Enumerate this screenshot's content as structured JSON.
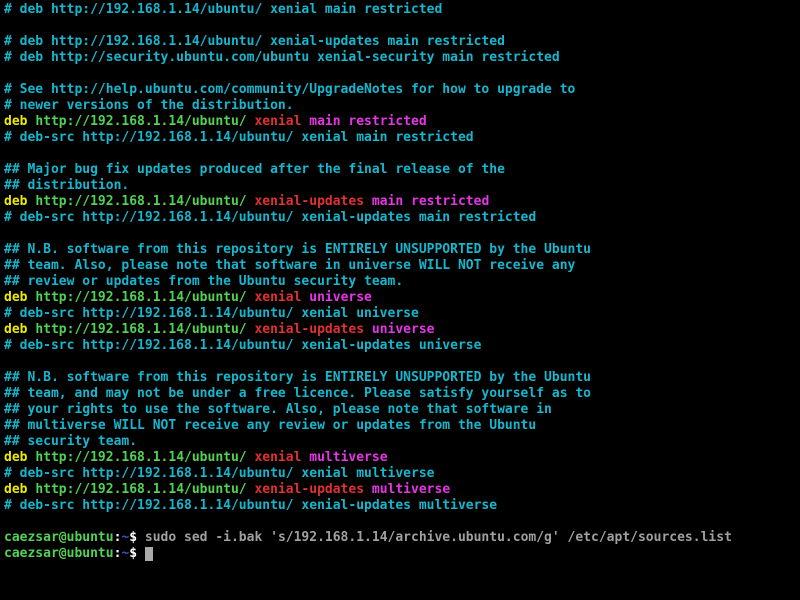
{
  "ip": "192.168.1.14",
  "dist": "xenial",
  "sec_host": "security.ubuntu.com",
  "help_url": "http://help.ubuntu.com/community/UpgradeNotes",
  "lines": {
    "l1": "# deb http://192.168.1.14/ubuntu/ xenial main restricted",
    "l3": "# deb http://192.168.1.14/ubuntu/ xenial-updates main restricted",
    "l4": "# deb http://security.ubuntu.com/ubuntu xenial-security main restricted",
    "l6": "# See http://help.ubuntu.com/community/UpgradeNotes for how to upgrade to",
    "l7": "# newer versions of the distribution.",
    "c_deb": "deb",
    "c_url": "http://192.168.1.14/ubuntu/",
    "c_xen": "xenial",
    "c_xenupd": "xenial-updates",
    "c_main": "main",
    "c_rest": "restricted",
    "c_univ": "universe",
    "c_multi": "multiverse",
    "l9": "# deb-src http://192.168.1.14/ubuntu/ xenial main restricted",
    "l11": "## Major bug fix updates produced after the final release of the",
    "l12": "## distribution.",
    "l14": "# deb-src http://192.168.1.14/ubuntu/ xenial-updates main restricted",
    "l16": "## N.B. software from this repository is ENTIRELY UNSUPPORTED by the Ubuntu",
    "l17": "## team. Also, please note that software in universe WILL NOT receive any",
    "l18": "## review or updates from the Ubuntu security team.",
    "l20": "# deb-src http://192.168.1.14/ubuntu/ xenial universe",
    "l22": "# deb-src http://192.168.1.14/ubuntu/ xenial-updates universe",
    "l24": "## N.B. software from this repository is ENTIRELY UNSUPPORTED by the Ubuntu",
    "l25": "## team, and may not be under a free licence. Please satisfy yourself as to",
    "l26": "## your rights to use the software. Also, please note that software in",
    "l27": "## multiverse WILL NOT receive any review or updates from the Ubuntu",
    "l28": "## security team.",
    "l30": "# deb-src http://192.168.1.14/ubuntu/ xenial multiverse",
    "l32": "# deb-src http://192.168.1.14/ubuntu/ xenial-updates multiverse"
  },
  "prompt": {
    "user_host": "caezsar@ubuntu",
    "sep": ":",
    "path": "~",
    "dollar": "$",
    "cmd1": "sudo sed -i.bak 's/192.168.1.14/archive.ubuntu.com/g' /etc/apt/sources.list"
  }
}
